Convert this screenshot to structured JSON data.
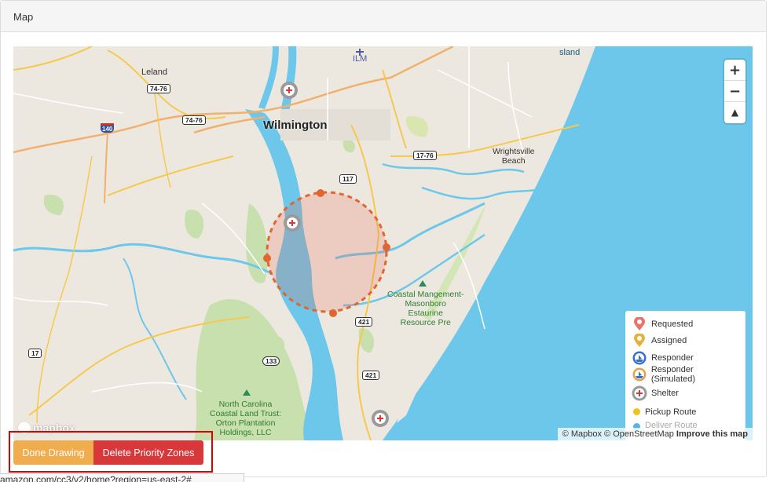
{
  "panel": {
    "title": "Map"
  },
  "map": {
    "places": {
      "wilmington": "Wilmington",
      "leland": "Leland",
      "ilm": "ILM",
      "wrightsville1": "Wrightsville",
      "wrightsville2": "Beach",
      "coastal1": "Coastal Mangement-",
      "coastal2": "Masonboro",
      "coastal3": "Estaurine",
      "coastal4": "Resource Pre",
      "nc1": "North Carolina",
      "nc2": "Coastal Land Trust:",
      "nc3": "Orton Plantation",
      "nc4": "Holdings, LLC",
      "island": "sland"
    },
    "shields": {
      "s1": "74-76",
      "s2": "74-76",
      "s3": "140",
      "s4": "117",
      "s5": "17-76",
      "s6": "421",
      "s7": "421",
      "s8": "133",
      "s9": "17"
    },
    "zoom": {
      "in": "+",
      "out": "−",
      "compass": "▲"
    },
    "attribution": {
      "mapbox": "© Mapbox",
      "osm": "© OpenStreetMap",
      "improve": "Improve this map"
    },
    "logo": "mapbox"
  },
  "legend": {
    "items": [
      {
        "label": "Requested",
        "icon": "requested-pin-icon",
        "color": "#e9736b"
      },
      {
        "label": "Assigned",
        "icon": "assigned-pin-icon",
        "color": "#e8b23a"
      },
      {
        "label": "Responder",
        "icon": "responder-boat-icon",
        "color": "#3a6fc8"
      },
      {
        "label": "Responder (Simulated)",
        "icon": "responder-simulated-icon",
        "color": "#e9a04a"
      },
      {
        "label": "Shelter",
        "icon": "shelter-icon",
        "color": "#888888"
      },
      {
        "label": "Pickup Route",
        "icon": "pickup-route-dot",
        "color": "#f3c21a"
      },
      {
        "label": "Deliver Route",
        "icon": "deliver-route-dot",
        "color": "#54b6e8"
      }
    ]
  },
  "actions": {
    "done": "Done Drawing",
    "delete": "Delete Priority Zones"
  },
  "status": {
    "url": "amazon.com/cc3/v2/home?region=us-east-2#"
  },
  "colors": {
    "water": "#6cc7ea",
    "land": "#ede8df",
    "park": "#bfdca2",
    "zone": "#e0662f",
    "done": "#f0ad4e",
    "delete": "#d9383a"
  }
}
